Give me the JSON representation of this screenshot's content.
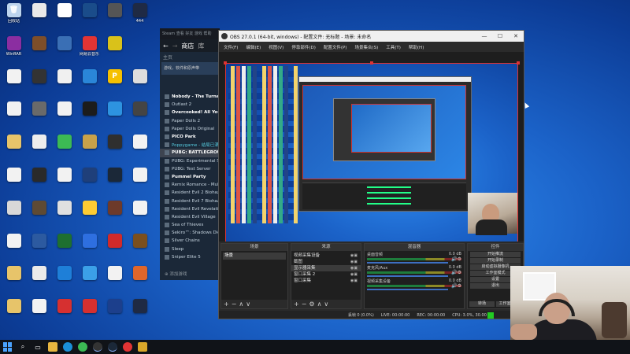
{
  "desktop": {
    "icons": [
      {
        "label": "回收站",
        "color": "#bcd4ee",
        "glyph": "🗑",
        "icon": "recycle-bin-icon"
      },
      {
        "label": "",
        "color": "#e9e9e9",
        "glyph": "",
        "icon": "document-icon"
      },
      {
        "label": "",
        "color": "#ffffff",
        "glyph": "",
        "icon": "document-icon"
      },
      {
        "label": "",
        "color": "#1a4c8a",
        "glyph": "",
        "icon": "app-icon"
      },
      {
        "label": "",
        "color": "#555555",
        "glyph": "",
        "icon": "app-icon"
      },
      {
        "label": "444",
        "color": "#1f2a44",
        "glyph": "",
        "icon": "app-icon"
      },
      {
        "label": "WinRAR",
        "color": "#8b2ea1",
        "glyph": "",
        "icon": "winrar-icon"
      },
      {
        "label": "",
        "color": "#7d4e2a",
        "glyph": "",
        "icon": "game-icon"
      },
      {
        "label": "",
        "color": "#3a6fb5",
        "glyph": "",
        "icon": "app-icon"
      },
      {
        "label": "网易云音乐",
        "color": "#e23434",
        "glyph": "",
        "icon": "netease-music-icon"
      },
      {
        "label": "",
        "color": "#d9c21a",
        "glyph": "",
        "icon": "app-icon"
      },
      {
        "label": "",
        "color": "",
        "glyph": "",
        "icon": "blank"
      },
      {
        "label": "",
        "color": "#f2f2f2",
        "glyph": "",
        "icon": "document-icon"
      },
      {
        "label": "",
        "color": "#333333",
        "glyph": "",
        "icon": "app-icon"
      },
      {
        "label": "",
        "color": "#f0f0f0",
        "glyph": "",
        "icon": "document-icon"
      },
      {
        "label": "",
        "color": "#2a86d8",
        "glyph": "",
        "icon": "app-icon"
      },
      {
        "label": "",
        "color": "#f5c000",
        "glyph": "P",
        "icon": "pubg-icon"
      },
      {
        "label": "",
        "color": "#dddddd",
        "glyph": "",
        "icon": "app-icon"
      },
      {
        "label": "",
        "color": "#f2f2f2",
        "glyph": "",
        "icon": "document-icon"
      },
      {
        "label": "",
        "color": "#6a6a6a",
        "glyph": "",
        "icon": "app-icon"
      },
      {
        "label": "",
        "color": "#f2f2f2",
        "glyph": "",
        "icon": "document-icon"
      },
      {
        "label": "",
        "color": "#1c1c1c",
        "glyph": "",
        "icon": "app-icon"
      },
      {
        "label": "",
        "color": "#2d93e0",
        "glyph": "",
        "icon": "edge-icon"
      },
      {
        "label": "",
        "color": "#444444",
        "glyph": "",
        "icon": "app-icon"
      },
      {
        "label": "",
        "color": "#e7c46a",
        "glyph": "",
        "icon": "folder-icon"
      },
      {
        "label": "",
        "color": "#ededed",
        "glyph": "",
        "icon": "document-icon"
      },
      {
        "label": "",
        "color": "#3cba54",
        "glyph": "",
        "icon": "app-icon"
      },
      {
        "label": "",
        "color": "#c9a24a",
        "glyph": "",
        "icon": "app-icon"
      },
      {
        "label": "",
        "color": "#2f2f2f",
        "glyph": "",
        "icon": "app-icon"
      },
      {
        "label": "",
        "color": "#f2f2f2",
        "glyph": "",
        "icon": "document-icon"
      },
      {
        "label": "",
        "color": "#f2f2f2",
        "glyph": "",
        "icon": "document-icon"
      },
      {
        "label": "",
        "color": "#2a2a2a",
        "glyph": "",
        "icon": "app-icon"
      },
      {
        "label": "",
        "color": "#f2f2f2",
        "glyph": "",
        "icon": "document-icon"
      },
      {
        "label": "",
        "color": "#1f3f7a",
        "glyph": "",
        "icon": "app-icon"
      },
      {
        "label": "",
        "color": "#1b2838",
        "glyph": "",
        "icon": "steam-icon"
      },
      {
        "label": "",
        "color": "#f2f2f2",
        "glyph": "",
        "icon": "document-icon"
      },
      {
        "label": "",
        "color": "#d8d8d8",
        "glyph": "",
        "icon": "app-icon"
      },
      {
        "label": "",
        "color": "#5e4a34",
        "glyph": "",
        "icon": "app-icon"
      },
      {
        "label": "",
        "color": "#e0e0e0",
        "glyph": "",
        "icon": "app-icon"
      },
      {
        "label": "",
        "color": "#ffcc33",
        "glyph": "",
        "icon": "app-icon"
      },
      {
        "label": "",
        "color": "#6d3a2a",
        "glyph": "",
        "icon": "app-icon"
      },
      {
        "label": "",
        "color": "#f2f2f2",
        "glyph": "",
        "icon": "document-icon"
      },
      {
        "label": "",
        "color": "#f2f2f2",
        "glyph": "",
        "icon": "document-icon"
      },
      {
        "label": "",
        "color": "#2c5aa0",
        "glyph": "",
        "icon": "app-icon"
      },
      {
        "label": "",
        "color": "#1e6f30",
        "glyph": "",
        "icon": "app-icon"
      },
      {
        "label": "",
        "color": "#2e6fe0",
        "glyph": "",
        "icon": "app-icon"
      },
      {
        "label": "",
        "color": "#d12a2a",
        "glyph": "",
        "icon": "app-icon"
      },
      {
        "label": "",
        "color": "#7a4f1f",
        "glyph": "",
        "icon": "app-icon"
      },
      {
        "label": "",
        "color": "#e7c46a",
        "glyph": "",
        "icon": "folder-icon"
      },
      {
        "label": "",
        "color": "#eaeaea",
        "glyph": "",
        "icon": "phone-icon"
      },
      {
        "label": "",
        "color": "#1e7fd8",
        "glyph": "",
        "icon": "app-icon"
      },
      {
        "label": "",
        "color": "#3ba0e8",
        "glyph": "",
        "icon": "app-icon"
      },
      {
        "label": "",
        "color": "#f2f2f2",
        "glyph": "",
        "icon": "app-icon"
      },
      {
        "label": "",
        "color": "#e0662a",
        "glyph": "",
        "icon": "app-icon"
      },
      {
        "label": "",
        "color": "#e7c46a",
        "glyph": "",
        "icon": "folder-icon"
      },
      {
        "label": "",
        "color": "#f2f2f2",
        "glyph": "",
        "icon": "document-icon"
      },
      {
        "label": "",
        "color": "#d63030",
        "glyph": "",
        "icon": "app-icon"
      },
      {
        "label": "",
        "color": "#d63030",
        "glyph": "",
        "icon": "app-icon"
      },
      {
        "label": "",
        "color": "#1c3f8c",
        "glyph": "",
        "icon": "app-icon"
      },
      {
        "label": "",
        "color": "#1f2a44",
        "glyph": "",
        "icon": "app-icon"
      }
    ]
  },
  "steam": {
    "top_bar": "Steam  查看  好友  游戏  帮助",
    "store_tab": "商店",
    "library_tab": "库",
    "home": "主页",
    "filter": "游戏，软件和原声带",
    "games": [
      {
        "name": "Nobody - The Turnaround",
        "cls": "b"
      },
      {
        "name": "Outlast 2",
        "cls": ""
      },
      {
        "name": "Overcooked! All You Can Eat",
        "cls": "b"
      },
      {
        "name": "Paper Dolls 2",
        "cls": ""
      },
      {
        "name": "Paper Dolls Original",
        "cls": ""
      },
      {
        "name": "PICO Park",
        "cls": "b"
      },
      {
        "name": "Poppygame - 结局已满",
        "cls": "hl"
      },
      {
        "name": "PUBG: BATTLEGROUNDS",
        "cls": "sel b"
      },
      {
        "name": "PUBG: Experimental Server",
        "cls": ""
      },
      {
        "name": "PUBG: Test Server",
        "cls": ""
      },
      {
        "name": "Pummel Party",
        "cls": "b"
      },
      {
        "name": "Remix Romance - Multiplayer",
        "cls": ""
      },
      {
        "name": "Resident Evil 2 Biohazard",
        "cls": ""
      },
      {
        "name": "Resident Evil 7 Biohazard",
        "cls": ""
      },
      {
        "name": "Resident Evil Revelations",
        "cls": ""
      },
      {
        "name": "Resident Evil Village",
        "cls": ""
      },
      {
        "name": "Sea of Thieves",
        "cls": ""
      },
      {
        "name": "Sekiro™: Shadows Die Twice",
        "cls": ""
      },
      {
        "name": "Silver Chains",
        "cls": ""
      },
      {
        "name": "Sleep",
        "cls": ""
      },
      {
        "name": "Sniper Elite 5",
        "cls": ""
      }
    ],
    "add_game": "添加游戏"
  },
  "obs": {
    "title": "OBS 27.0.1 (64-bit, windows) - 配置文件: 无标题 - 场景: 未命名",
    "menu": [
      "文件(F)",
      "编辑(E)",
      "视图(V)",
      "停靠部件(D)",
      "配置文件(P)",
      "场景集合(S)",
      "工具(T)",
      "帮助(H)"
    ],
    "docks": {
      "scenes": "场景",
      "sources": "来源",
      "mixer": "混音器",
      "controls": "控件"
    },
    "scene": "场景",
    "sources_list": [
      {
        "name": "视频采集设备",
        "sel": false
      },
      {
        "name": "截图",
        "sel": false
      },
      {
        "name": "显示器采集",
        "sel": true
      },
      {
        "name": "窗口采集 2",
        "sel": false
      },
      {
        "name": "窗口采集",
        "sel": false
      }
    ],
    "mixer_list": [
      {
        "name": "桌面音频",
        "db": "0.0 dB"
      },
      {
        "name": "麦克风/Aux",
        "db": "0.0 dB"
      },
      {
        "name": "视频采集设备",
        "db": "0.0 dB"
      }
    ],
    "controls_list": [
      "开始推流",
      "开始录制",
      "启动虚拟摄像机",
      "工作室模式",
      "设置",
      "退出"
    ],
    "transition_a": "转场",
    "transition_b": "工作室模式",
    "status": [
      "丢帧 0 (0.0%)",
      "LIVE: 00:00:00",
      "REC: 00:00:00",
      "CPU: 3.0%, 30.00 fps"
    ]
  },
  "taskbar": {
    "items": [
      "search",
      "task-view",
      "file-explorer",
      "edge",
      "chrome",
      "obs",
      "steam",
      "netease",
      "app"
    ]
  }
}
